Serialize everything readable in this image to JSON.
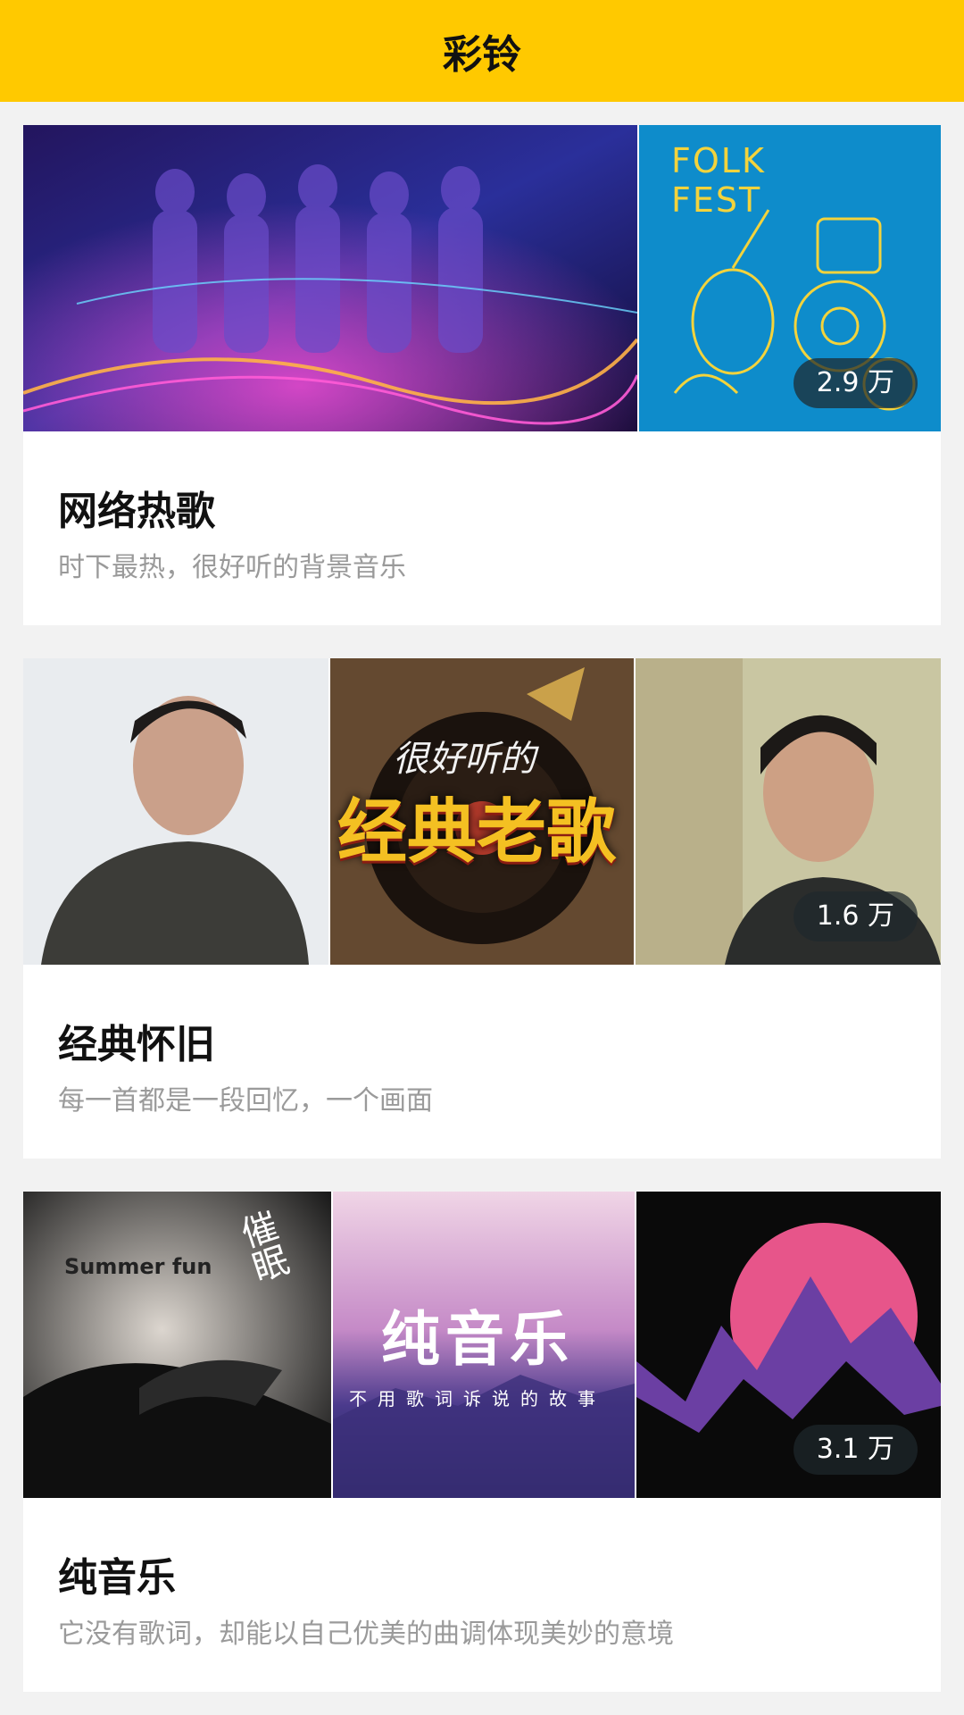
{
  "header": {
    "title": "彩铃"
  },
  "categories": [
    {
      "title": "网络热歌",
      "subtitle": "时下最热，很好听的背景音乐",
      "play_count": "2.9 万",
      "thumb_texts": {
        "folk_title_1": "FOLK",
        "folk_title_2": "FEST"
      }
    },
    {
      "title": "经典怀旧",
      "subtitle": "每一首都是一段回忆，一个画面",
      "play_count": "1.6 万",
      "thumb_texts": {
        "cover_title": "经典老歌",
        "cover_script": "很好听的"
      }
    },
    {
      "title": "纯音乐",
      "subtitle": "它没有歌词，却能以自己优美的曲调体现美妙的意境",
      "play_count": "3.1 万",
      "thumb_texts": {
        "summer": "Summer fun",
        "hypnosis": "催眠",
        "pure_title": "纯音乐",
        "pure_sub": "不用歌词诉说的故事"
      }
    }
  ]
}
